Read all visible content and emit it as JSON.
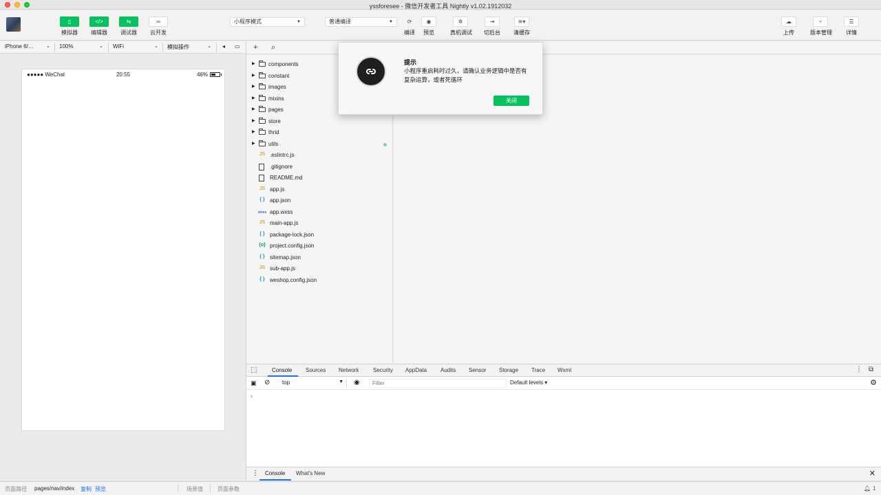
{
  "window": {
    "title": "yssforesee - 微信开发者工具 Nightly v1.02.1912032"
  },
  "toolbar": {
    "simulator": "模拟器",
    "editor": "编辑器",
    "debugger": "调试器",
    "cloud": "云开发",
    "mode_select": "小程序模式",
    "compile_select": "普通编译",
    "compile": "编译",
    "preview": "预览",
    "real_debug": "真机调试",
    "background": "切后台",
    "clear_cache": "清缓存",
    "upload": "上传",
    "version": "版本管理",
    "details": "详情"
  },
  "simbar": {
    "device": "iPhone 6/…",
    "zoom": "100%",
    "network": "WiFi",
    "operation": "模拟操作"
  },
  "phone": {
    "carrier": "●●●●● WeChat",
    "time": "20:55",
    "battery": "46%"
  },
  "explorer": {
    "folders": [
      "components",
      "constant",
      "images",
      "mixins",
      "pages",
      "store",
      "thrid",
      "utils"
    ],
    "files": [
      {
        "name": ".eslintrc.js",
        "icon": "JS",
        "type": "js"
      },
      {
        "name": ".gitignore",
        "icon": "",
        "type": "doc"
      },
      {
        "name": "README.md",
        "icon": "",
        "type": "doc"
      },
      {
        "name": "app.js",
        "icon": "JS",
        "type": "js"
      },
      {
        "name": "app.json",
        "icon": "{ }",
        "type": "json"
      },
      {
        "name": "app.wxss",
        "icon": "wxss",
        "type": "wxss"
      },
      {
        "name": "main-app.js",
        "icon": "JS",
        "type": "js"
      },
      {
        "name": "package-lock.json",
        "icon": "{ }",
        "type": "json"
      },
      {
        "name": "project.config.json",
        "icon": "{o}",
        "type": "cfg"
      },
      {
        "name": "sitemap.json",
        "icon": "{ }",
        "type": "json"
      },
      {
        "name": "sub-app.js",
        "icon": "JS",
        "type": "js"
      },
      {
        "name": "weshop.config.json",
        "icon": "{ }",
        "type": "json"
      }
    ]
  },
  "devtools": {
    "tabs": [
      "Console",
      "Sources",
      "Network",
      "Security",
      "AppData",
      "Audits",
      "Sensor",
      "Storage",
      "Trace",
      "Wxml"
    ],
    "context": "top",
    "filter_placeholder": "Filter",
    "levels": "Default levels",
    "prompt": "›",
    "drawer_tabs": [
      "Console",
      "What's New"
    ]
  },
  "bottombar": {
    "path_label": "页面路径",
    "path": "pages/nav/index",
    "copy": "复制",
    "preview": "预览",
    "scene": "场景值",
    "params": "页面参数",
    "notifications": "1"
  },
  "dialog": {
    "title": "提示",
    "message": "小程序重启耗时过久，请确认业务逻辑中是否有复杂运算，或者死循环",
    "close": "关闭"
  },
  "colors": {
    "accent": "#07c160",
    "link": "#1a73e8"
  }
}
